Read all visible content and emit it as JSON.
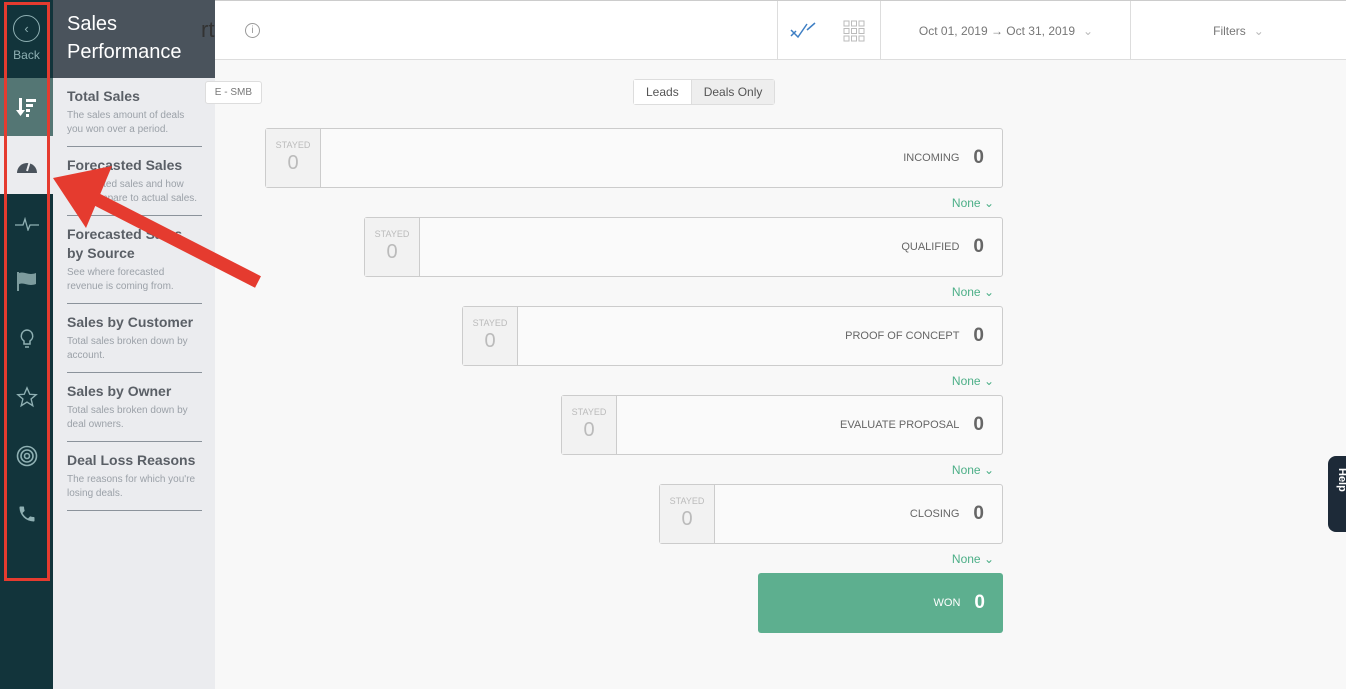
{
  "rail": {
    "back_label": "Back",
    "items": [
      {
        "icon": "sort-descending-icon"
      },
      {
        "icon": "dashboard-gauge-icon"
      },
      {
        "icon": "pulse-icon"
      },
      {
        "icon": "flag-icon"
      },
      {
        "icon": "lightbulb-icon"
      },
      {
        "icon": "star-icon"
      },
      {
        "icon": "target-icon"
      },
      {
        "icon": "phone-icon"
      }
    ]
  },
  "panel": {
    "title": "Sales Performance",
    "items": [
      {
        "title": "Total Sales",
        "desc": "The sales amount of deals you won over a period."
      },
      {
        "title": "Forecasted Sales",
        "desc": "Forecasted sales and how they compare to actual sales."
      },
      {
        "title": "Forecasted Sales by Source",
        "desc": "See where forecasted revenue is coming from."
      },
      {
        "title": "Sales by Customer",
        "desc": "Total sales broken down by account."
      },
      {
        "title": "Sales by Owner",
        "desc": "Total sales broken down by deal owners."
      },
      {
        "title": "Deal Loss Reasons",
        "desc": "The reasons for which you're losing deals."
      }
    ]
  },
  "header": {
    "title_fragment": "rt",
    "info": "i",
    "date_range": "Oct 01, 2019 → Oct 31, 2019",
    "filters": "Filters"
  },
  "tag": "E - SMB",
  "toggle": {
    "leads": "Leads",
    "deals_only": "Deals Only"
  },
  "stages": [
    {
      "name": "INCOMING",
      "count": "0",
      "stayed_label": "STAYED",
      "stayed": "0",
      "conversion": "None"
    },
    {
      "name": "QUALIFIED",
      "count": "0",
      "stayed_label": "STAYED",
      "stayed": "0",
      "conversion": "None"
    },
    {
      "name": "PROOF OF CONCEPT",
      "count": "0",
      "stayed_label": "STAYED",
      "stayed": "0",
      "conversion": "None"
    },
    {
      "name": "EVALUATE PROPOSAL",
      "count": "0",
      "stayed_label": "STAYED",
      "stayed": "0",
      "conversion": "None"
    },
    {
      "name": "CLOSING",
      "count": "0",
      "stayed_label": "STAYED",
      "stayed": "0",
      "conversion": "None"
    }
  ],
  "won": {
    "name": "WON",
    "count": "0"
  },
  "help": "Help",
  "colors": {
    "rail": "#12343b",
    "won": "#5daf8f",
    "accent": "#4caf87",
    "annotation": "#e53b2f"
  }
}
